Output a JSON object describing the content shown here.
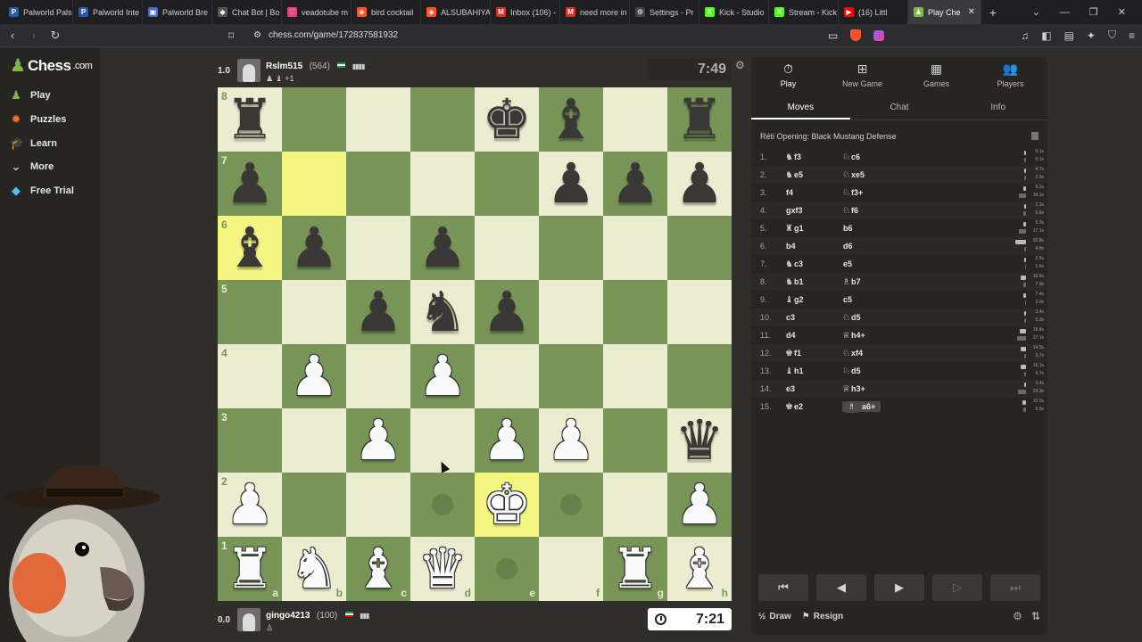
{
  "browser": {
    "tabs": [
      {
        "label": "Palworld Pals",
        "fav": "P",
        "color": "#2c5aa0"
      },
      {
        "label": "Palworld Inte",
        "fav": "P",
        "color": "#2c5aa0"
      },
      {
        "label": "Palworld Bre",
        "fav": "▣",
        "color": "#4a6cc8"
      },
      {
        "label": "Chat Bot | Bo",
        "fav": "◆",
        "color": "#555"
      },
      {
        "label": "veadotube m",
        "fav": "♡",
        "color": "#e0457b"
      },
      {
        "label": "bird cocktail",
        "fav": "◈",
        "color": "#fb542b"
      },
      {
        "label": "ALSUBAHIYA",
        "fav": "◈",
        "color": "#fb542b"
      },
      {
        "label": "Inbox (106) -",
        "fav": "M",
        "color": "#d93025"
      },
      {
        "label": "need more in",
        "fav": "M",
        "color": "#d93025"
      },
      {
        "label": "Settings - Pr",
        "fav": "⚙",
        "color": "#444"
      },
      {
        "label": "Kick - Studio",
        "fav": "K",
        "color": "#53fc18"
      },
      {
        "label": "Stream - Kick",
        "fav": "K",
        "color": "#53fc18"
      },
      {
        "label": "(16) Littl",
        "fav": "▶",
        "color": "#ff0000"
      }
    ],
    "active_tab": {
      "label": "Play Che",
      "fav": "♟",
      "color": "#81b64c"
    },
    "url": "chess.com/game/172837581932"
  },
  "sidebar": {
    "logo_text": "Chess",
    "logo_suffix": ".com",
    "items": [
      {
        "label": "Play",
        "icon": "♟",
        "color": "#81b64c"
      },
      {
        "label": "Puzzles",
        "icon": "✹",
        "color": "#f7712b"
      },
      {
        "label": "Learn",
        "icon": "🎓",
        "color": "#29a7df"
      },
      {
        "label": "More",
        "icon": "⌄",
        "color": "#ccc"
      },
      {
        "label": "Free Trial",
        "icon": "◆",
        "color": "#4fc3f7"
      }
    ]
  },
  "top_player": {
    "score": "1.0",
    "name": "Rslm515",
    "rating": "(564)",
    "captured": "+1",
    "clock": "7:49"
  },
  "bottom_player": {
    "score": "0.0",
    "name": "gingo4213",
    "rating": "(100)",
    "clock": "7:21"
  },
  "board": {
    "light": "#ebecd0",
    "dark": "#779556",
    "highlight": "#f5f682",
    "ranks": [
      "8",
      "7",
      "6",
      "5",
      "4",
      "3",
      "2",
      "1"
    ],
    "files": [
      "a",
      "b",
      "c",
      "d",
      "e",
      "f",
      "g",
      "h"
    ],
    "highlighted": [
      "b7",
      "a6",
      "e2"
    ],
    "dots": [
      "d2",
      "f2",
      "e1"
    ],
    "pieces": {
      "a8": "bR",
      "e8": "bK",
      "f8": "bB",
      "h8": "bR",
      "a7": "bP",
      "f7": "bP",
      "g7": "bP",
      "h7": "bP",
      "a6": "bB",
      "b6": "bP",
      "d6": "bP",
      "c5": "bP",
      "d5": "bN",
      "e5": "bP",
      "b4": "wP",
      "d4": "wP",
      "c3": "wP",
      "e3": "wP",
      "f3": "wP",
      "h3": "bQ",
      "a2": "wP",
      "e2": "wK",
      "h2": "wP",
      "a1": "wR",
      "b1": "wN",
      "c1": "wB",
      "d1": "wQ",
      "g1": "wR",
      "h1": "wB"
    }
  },
  "panel": {
    "tabs": [
      {
        "label": "Play",
        "icon": "⏱"
      },
      {
        "label": "New Game",
        "icon": "⊞"
      },
      {
        "label": "Games",
        "icon": "▦"
      },
      {
        "label": "Players",
        "icon": "👥"
      }
    ],
    "subtabs": [
      "Moves",
      "Chat",
      "Info"
    ],
    "opening": "Réti Opening: Black Mustang Defense",
    "moves": [
      {
        "n": "1.",
        "w": "f3",
        "wf": "♞",
        "b": "c6",
        "bf": "♘",
        "wt": "0.1s",
        "bt": "0.1s",
        "ww": 2,
        "bw": 2
      },
      {
        "n": "2.",
        "w": "e5",
        "wf": "♞",
        "b": "xe5",
        "bf": "♘",
        "wt": "4.7s",
        "bt": "2.5s",
        "ww": 2,
        "bw": 2
      },
      {
        "n": "3.",
        "w": "f4",
        "wf": "",
        "b": "f3+",
        "bf": "♘",
        "wt": "6.2s",
        "bt": "18.1s",
        "ww": 3,
        "bw": 8
      },
      {
        "n": "4.",
        "w": "gxf3",
        "wf": "",
        "b": "f6",
        "bf": "♘",
        "wt": "2.3s",
        "bt": "5.6s",
        "ww": 2,
        "bw": 3
      },
      {
        "n": "5.",
        "w": "g1",
        "wf": "♜",
        "b": "b6",
        "bf": "",
        "wt": "5.9s",
        "bt": "17.1s",
        "ww": 3,
        "bw": 8
      },
      {
        "n": "6.",
        "w": "b4",
        "wf": "",
        "b": "d6",
        "bf": "",
        "wt": "32.8s",
        "bt": "4.8s",
        "ww": 12,
        "bw": 2
      },
      {
        "n": "7.",
        "w": "c3",
        "wf": "♞",
        "b": "e5",
        "bf": "",
        "wt": "2.5s",
        "bt": "1.6s",
        "ww": 2,
        "bw": 1
      },
      {
        "n": "8.",
        "w": "b1",
        "wf": "♞",
        "b": "b7",
        "bf": "♗",
        "wt": "16.5s",
        "bt": "7.9s",
        "ww": 6,
        "bw": 3
      },
      {
        "n": "9.",
        "w": "g2",
        "wf": "♝",
        "b": "c5",
        "bf": "",
        "wt": "7.4s",
        "bt": "2.0s",
        "ww": 3,
        "bw": 1
      },
      {
        "n": "10.",
        "w": "c3",
        "wf": "",
        "b": "d5",
        "bf": "♘",
        "wt": "3.4s",
        "bt": "5.3s",
        "ww": 2,
        "bw": 2
      },
      {
        "n": "11.",
        "w": "d4",
        "wf": "",
        "b": "h4+",
        "bf": "♕",
        "wt": "18.8s",
        "bt": "27.1s",
        "ww": 7,
        "bw": 10
      },
      {
        "n": "12.",
        "w": "f1",
        "wf": "♚",
        "b": "xf4",
        "bf": "♘",
        "wt": "14.5s",
        "bt": "3.7s",
        "ww": 6,
        "bw": 2
      },
      {
        "n": "13.",
        "w": "h1",
        "wf": "♝",
        "b": "d5",
        "bf": "♘",
        "wt": "16.1s",
        "bt": "4.7s",
        "ww": 6,
        "bw": 2
      },
      {
        "n": "14.",
        "w": "e3",
        "wf": "",
        "b": "h3+",
        "bf": "♕",
        "wt": "3.4s",
        "bt": "23.3s",
        "ww": 2,
        "bw": 9
      },
      {
        "n": "15.",
        "w": "e2",
        "wf": "♚",
        "b": "a6+",
        "bf": "♗",
        "wt": "10.9s",
        "bt": "6.6s",
        "ww": 4,
        "bw": 3
      }
    ],
    "draw_label": "Draw",
    "resign_label": "Resign"
  }
}
